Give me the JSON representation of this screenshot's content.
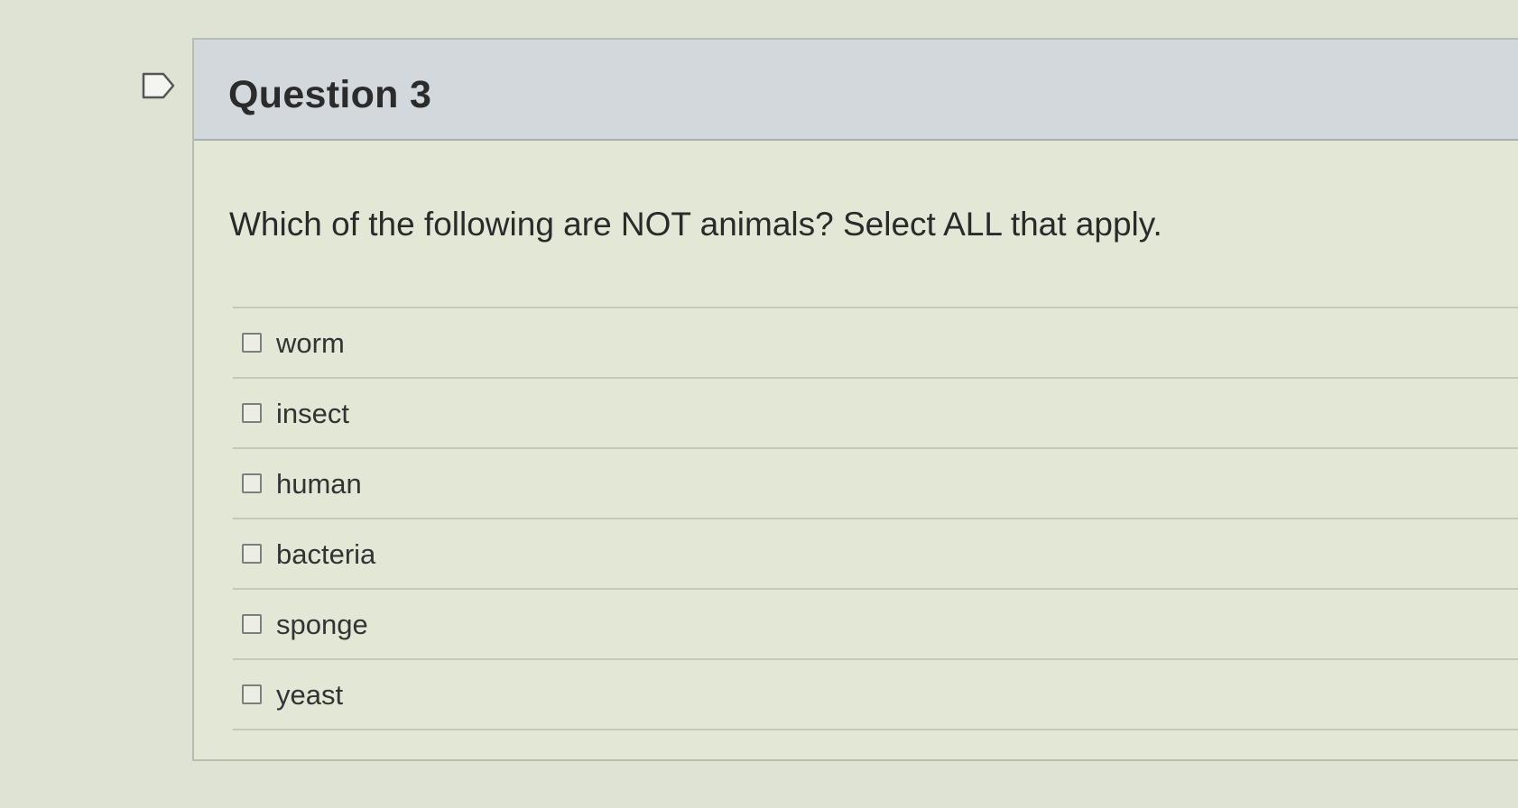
{
  "question": {
    "title": "Question 3",
    "flag_icon": "flag-icon",
    "text": "Which of the following are NOT animals?  Select ALL that apply.",
    "answers": [
      {
        "label": "worm",
        "checked": false
      },
      {
        "label": "insect",
        "checked": false
      },
      {
        "label": "human",
        "checked": false
      },
      {
        "label": "bacteria",
        "checked": false
      },
      {
        "label": "sponge",
        "checked": false
      },
      {
        "label": "yeast",
        "checked": false
      }
    ]
  }
}
